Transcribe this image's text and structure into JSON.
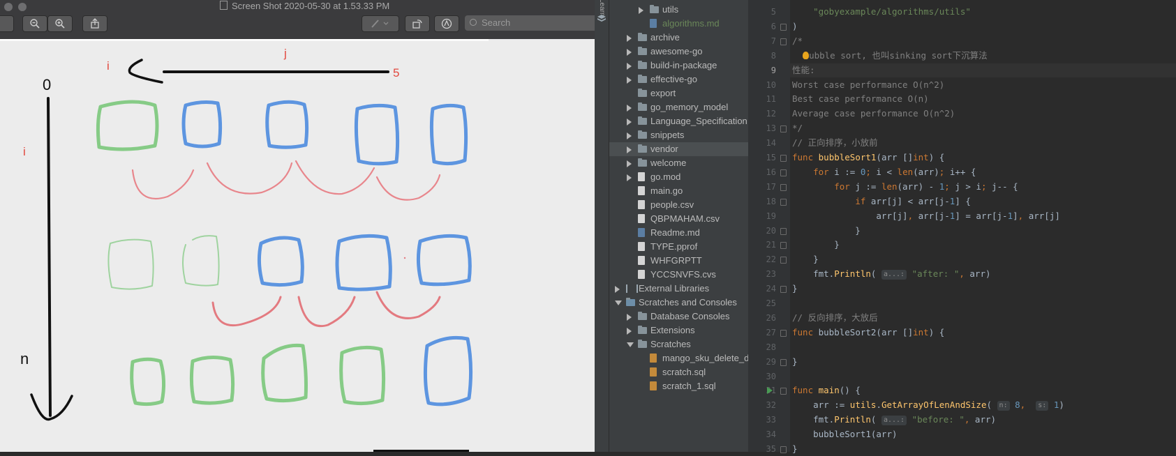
{
  "preview": {
    "title": "Screen Shot 2020-05-30 at 1.53.33 PM",
    "search_placeholder": "Search",
    "drawing": {
      "labels": {
        "top_i": "i",
        "top_j": "j",
        "top_5": "5",
        "zero": "0",
        "side_i": "i",
        "n": "n"
      }
    }
  },
  "ide": {
    "sidebar_tab": "Learn",
    "tree": [
      {
        "label": "utils",
        "kind": "folder",
        "state": "collapsed",
        "indent": 2
      },
      {
        "label": "algorithms.md",
        "kind": "md",
        "state": "none",
        "indent": 2,
        "color": "#6a8759"
      },
      {
        "label": "archive",
        "kind": "folder",
        "state": "collapsed",
        "indent": 1
      },
      {
        "label": "awesome-go",
        "kind": "folder",
        "state": "collapsed",
        "indent": 1
      },
      {
        "label": "build-in-package",
        "kind": "folder",
        "state": "collapsed",
        "indent": 1
      },
      {
        "label": "effective-go",
        "kind": "folder",
        "state": "collapsed",
        "indent": 1
      },
      {
        "label": "export",
        "kind": "folder",
        "state": "none",
        "indent": 1
      },
      {
        "label": "go_memory_model",
        "kind": "folder",
        "state": "collapsed",
        "indent": 1
      },
      {
        "label": "Language_Specification",
        "kind": "folder",
        "state": "collapsed",
        "indent": 1
      },
      {
        "label": "snippets",
        "kind": "folder",
        "state": "collapsed",
        "indent": 1
      },
      {
        "label": "vendor",
        "kind": "folder",
        "state": "collapsed",
        "indent": 1,
        "selected": true
      },
      {
        "label": "welcome",
        "kind": "folder",
        "state": "collapsed",
        "indent": 1
      },
      {
        "label": "go.mod",
        "kind": "file",
        "state": "collapsed",
        "indent": 1
      },
      {
        "label": "main.go",
        "kind": "file",
        "state": "none",
        "indent": 1
      },
      {
        "label": "people.csv",
        "kind": "file",
        "state": "none",
        "indent": 1
      },
      {
        "label": "QBPMAHAM.csv",
        "kind": "file",
        "state": "none",
        "indent": 1
      },
      {
        "label": "Readme.md",
        "kind": "md",
        "state": "none",
        "indent": 1
      },
      {
        "label": "TYPE.pprof",
        "kind": "file",
        "state": "none",
        "indent": 1
      },
      {
        "label": "WHFGRPTT",
        "kind": "file",
        "state": "none",
        "indent": 1
      },
      {
        "label": "YCCSNVFS.cvs",
        "kind": "file",
        "state": "none",
        "indent": 1
      },
      {
        "label": "External Libraries",
        "kind": "lib",
        "state": "collapsed",
        "indent": 0
      },
      {
        "label": "Scratches and Consoles",
        "kind": "scratch",
        "state": "expanded",
        "indent": 0
      },
      {
        "label": "Database Consoles",
        "kind": "folder",
        "state": "collapsed",
        "indent": 1
      },
      {
        "label": "Extensions",
        "kind": "folder",
        "state": "collapsed",
        "indent": 1
      },
      {
        "label": "Scratches",
        "kind": "folder",
        "state": "expanded",
        "indent": 1
      },
      {
        "label": "mango_sku_delete_du",
        "kind": "sql",
        "state": "none",
        "indent": 2
      },
      {
        "label": "scratch.sql",
        "kind": "sql",
        "state": "none",
        "indent": 2
      },
      {
        "label": "scratch_1.sql",
        "kind": "sql",
        "state": "none",
        "indent": 2
      }
    ],
    "code_lines": [
      {
        "n": "5",
        "html": "    <span class='str'>\"gobyexample/algorithms/utils\"</span>"
      },
      {
        "n": "6",
        "html": ")"
      },
      {
        "n": "7",
        "html": "<span class='cm'>/*</span>"
      },
      {
        "n": "8",
        "html": "  <span class='bulb'></span><span class='cm'>ubble sort, 也叫sinking sort下沉算法</span>"
      },
      {
        "n": "9",
        "html": "<span class='cm'>性能:</span>",
        "current": true
      },
      {
        "n": "10",
        "html": "<span class='cm'>Worst case performance O(n^2)</span>"
      },
      {
        "n": "11",
        "html": "<span class='cm'>Best case performance O(n)</span>"
      },
      {
        "n": "12",
        "html": "<span class='cm'>Average case performance O(n^2)</span>"
      },
      {
        "n": "13",
        "html": "<span class='cm'>*/</span>"
      },
      {
        "n": "14",
        "html": "<span class='cm'>// 正向排序，小放前</span>"
      },
      {
        "n": "15",
        "html": "<span class='kw'>func</span> <span class='fn'>bubbleSort1</span>(arr []<span class='kw'>int</span>) {"
      },
      {
        "n": "16",
        "html": "    <span class='kw'>for</span> i := <span class='num'>0</span><span class='kw'>;</span> i &lt; <span class='kw'>len</span>(arr)<span class='kw'>;</span> i++ {"
      },
      {
        "n": "17",
        "html": "        <span class='kw'>for</span> j := <span class='kw'>len</span>(arr) - <span class='num'>1</span><span class='kw'>;</span> j &gt; i<span class='kw'>;</span> j-- {"
      },
      {
        "n": "18",
        "html": "            <span class='kw'>if</span> arr[j] &lt; arr[j-<span class='num'>1</span>] {"
      },
      {
        "n": "19",
        "html": "                arr[j]<span class='kw'>,</span> arr[j-<span class='num'>1</span>] = arr[j-<span class='num'>1</span>]<span class='kw'>,</span> arr[j]"
      },
      {
        "n": "20",
        "html": "            }"
      },
      {
        "n": "21",
        "html": "        }"
      },
      {
        "n": "22",
        "html": "    }"
      },
      {
        "n": "23",
        "html": "    fmt.<span class='fn'>Println</span>( <span class='hint'>a...:</span> <span class='str'>\"after: \"</span><span class='kw'>,</span> arr)"
      },
      {
        "n": "24",
        "html": "}"
      },
      {
        "n": "25",
        "html": ""
      },
      {
        "n": "26",
        "html": "<span class='cm'>// 反向排序，大放后</span>"
      },
      {
        "n": "27",
        "html": "<span class='kw'>func</span> bubbleSort2(arr []<span class='kw'>int</span>) {"
      },
      {
        "n": "28",
        "html": ""
      },
      {
        "n": "29",
        "html": "}"
      },
      {
        "n": "30",
        "html": ""
      },
      {
        "n": "31",
        "html": "<span class='kw'>func</span> <span class='fn'>main</span>() {",
        "run": true
      },
      {
        "n": "32",
        "html": "    arr := <span class='fn'>utils</span>.<span class='fn'>GetArrayOfLenAndSize</span>( <span class='hint'>n:</span> <span class='num'>8</span><span class='kw'>,</span>  <span class='hint'>s:</span> <span class='num'>1</span>)"
      },
      {
        "n": "33",
        "html": "    fmt.<span class='fn'>Println</span>( <span class='hint'>a...:</span> <span class='str'>\"before: \"</span><span class='kw'>,</span> arr)"
      },
      {
        "n": "34",
        "html": "    bubbleSort1(arr)"
      },
      {
        "n": "35",
        "html": "}"
      }
    ],
    "fold_marker_lines": [
      6,
      7,
      13,
      15,
      16,
      17,
      18,
      20,
      21,
      22,
      24,
      27,
      29,
      31,
      35
    ]
  }
}
